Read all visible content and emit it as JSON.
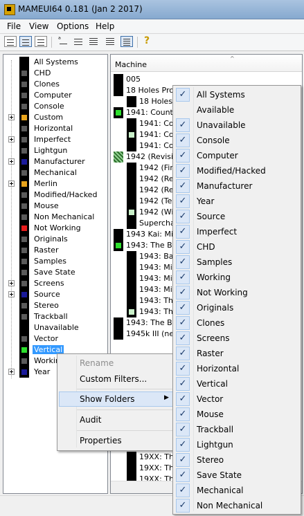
{
  "window": {
    "title": "MAMEUI64 0.181 (Jan  2 2017)"
  },
  "menu": [
    "File",
    "View",
    "Options",
    "Help"
  ],
  "toolbar": {
    "buttons": [
      "large-icons-icon",
      "small-icons-icon",
      "list-icon",
      "details-icon",
      "grouped-icon",
      "help-icon"
    ]
  },
  "tree": {
    "items": [
      {
        "label": "All Systems",
        "expandable": false,
        "icon_color": "#000000"
      },
      {
        "label": "CHD",
        "expandable": false,
        "icon_color": "#5a5a5a"
      },
      {
        "label": "Clones",
        "expandable": false,
        "icon_color": "#5a5a5a"
      },
      {
        "label": "Computer",
        "expandable": false,
        "icon_color": "#5a5a5a"
      },
      {
        "label": "Console",
        "expandable": false,
        "icon_color": "#5a5a5a"
      },
      {
        "label": "Custom",
        "expandable": true,
        "icon_color": "#e8a41c"
      },
      {
        "label": "Horizontal",
        "expandable": false,
        "icon_color": "#5a5a5a"
      },
      {
        "label": "Imperfect",
        "expandable": true,
        "icon_color": "#5a5a5a"
      },
      {
        "label": "Lightgun",
        "expandable": false,
        "icon_color": "#5a5a5a"
      },
      {
        "label": "Manufacturer",
        "expandable": true,
        "icon_color": "#1a1a9a"
      },
      {
        "label": "Mechanical",
        "expandable": false,
        "icon_color": "#5a5a5a"
      },
      {
        "label": "Merlin",
        "expandable": true,
        "icon_color": "#e8a41c"
      },
      {
        "label": "Modified/Hacked",
        "expandable": false,
        "icon_color": "#5a5a5a"
      },
      {
        "label": "Mouse",
        "expandable": false,
        "icon_color": "#5a5a5a"
      },
      {
        "label": "Non Mechanical",
        "expandable": false,
        "icon_color": "#5a5a5a"
      },
      {
        "label": "Not Working",
        "expandable": false,
        "icon_color": "#e81c1c"
      },
      {
        "label": "Originals",
        "expandable": false,
        "icon_color": "#5a5a5a"
      },
      {
        "label": "Raster",
        "expandable": false,
        "icon_color": "#5a5a5a"
      },
      {
        "label": "Samples",
        "expandable": false,
        "icon_color": "#5a5a5a"
      },
      {
        "label": "Save State",
        "expandable": false,
        "icon_color": "#5a5a5a"
      },
      {
        "label": "Screens",
        "expandable": true,
        "icon_color": "#5a5a5a"
      },
      {
        "label": "Source",
        "expandable": true,
        "icon_color": "#1a1a9a"
      },
      {
        "label": "Stereo",
        "expandable": false,
        "icon_color": "#5a5a5a"
      },
      {
        "label": "Trackball",
        "expandable": false,
        "icon_color": "#5a5a5a"
      },
      {
        "label": "Unavailable",
        "expandable": false,
        "icon_color": "#000000"
      },
      {
        "label": "Vector",
        "expandable": false,
        "icon_color": "#5a5a5a"
      },
      {
        "label": "Vertical",
        "expandable": false,
        "icon_color": "#2ee02e",
        "selected": true
      },
      {
        "label": "Working",
        "expandable": false,
        "icon_color": "#5a5a5a"
      },
      {
        "label": "Year",
        "expandable": true,
        "icon_color": "#1a1a9a"
      }
    ]
  },
  "list": {
    "column_header": "Machine",
    "rows": [
      {
        "text": "005",
        "indent": 0,
        "icon": "black"
      },
      {
        "text": "18 Holes Pro G",
        "indent": 0,
        "icon": "black"
      },
      {
        "text": "18 Holes P",
        "indent": 1,
        "icon": "black"
      },
      {
        "text": "1941: Counter",
        "indent": 0,
        "icon": "green"
      },
      {
        "text": "1941: Cou",
        "indent": 1,
        "icon": "black"
      },
      {
        "text": "1941: Cou",
        "indent": 1,
        "icon": "lightgreen"
      },
      {
        "text": "1941: Cou",
        "indent": 1,
        "icon": "black"
      },
      {
        "text": "1942 (Revision",
        "indent": 0,
        "icon": "hatch"
      },
      {
        "text": "1942 (Firs",
        "indent": 1,
        "icon": "black"
      },
      {
        "text": "1942 (Rev",
        "indent": 1,
        "icon": "black"
      },
      {
        "text": "1942 (Rev",
        "indent": 1,
        "icon": "black"
      },
      {
        "text": "1942 (Tec",
        "indent": 1,
        "icon": "black"
      },
      {
        "text": "1942 (Will",
        "indent": 1,
        "icon": "lightgreen"
      },
      {
        "text": "Supercha",
        "indent": 1,
        "icon": "black"
      },
      {
        "text": "1943 Kai: Mid",
        "indent": 0,
        "icon": "black"
      },
      {
        "text": "1943: The Ba",
        "indent": 0,
        "icon": "green"
      },
      {
        "text": "1943: Bat",
        "indent": 1,
        "icon": "black"
      },
      {
        "text": "1943: Mid",
        "indent": 1,
        "icon": "black"
      },
      {
        "text": "1943: Mid",
        "indent": 1,
        "icon": "black"
      },
      {
        "text": "1943: Mid",
        "indent": 1,
        "icon": "black"
      },
      {
        "text": "1943: The",
        "indent": 1,
        "icon": "black"
      },
      {
        "text": "1943: The",
        "indent": 1,
        "icon": "lightgreen"
      },
      {
        "text": "1943: The Ba",
        "indent": 0,
        "icon": "black"
      },
      {
        "text": "1945k III (new",
        "indent": 0,
        "icon": "black"
      }
    ],
    "lower_rows": [
      {
        "text": "19XX: The",
        "indent": 1,
        "icon": "black"
      },
      {
        "text": "19XX: The",
        "indent": 1,
        "icon": "black"
      },
      {
        "text": "19XX: The",
        "indent": 1,
        "icon": "black"
      }
    ]
  },
  "context_menu": {
    "items": [
      {
        "label": "Rename",
        "disabled": true
      },
      {
        "label": "Custom Filters..."
      },
      {
        "label": "Show Folders",
        "submenu": true,
        "highlighted": true
      },
      {
        "label": "Audit"
      },
      {
        "label": "Properties"
      }
    ]
  },
  "show_folders_submenu": {
    "items": [
      {
        "label": "All Systems",
        "checked": true
      },
      {
        "label": "Available",
        "checked": false
      },
      {
        "label": "Unavailable",
        "checked": true
      },
      {
        "label": "Console",
        "checked": true
      },
      {
        "label": "Computer",
        "checked": true
      },
      {
        "label": "Modified/Hacked",
        "checked": true
      },
      {
        "label": "Manufacturer",
        "checked": true
      },
      {
        "label": "Year",
        "checked": true
      },
      {
        "label": "Source",
        "checked": true
      },
      {
        "label": "Imperfect",
        "checked": true
      },
      {
        "label": "CHD",
        "checked": true
      },
      {
        "label": "Samples",
        "checked": true
      },
      {
        "label": "Working",
        "checked": true
      },
      {
        "label": "Not Working",
        "checked": true
      },
      {
        "label": "Originals",
        "checked": true
      },
      {
        "label": "Clones",
        "checked": true
      },
      {
        "label": "Screens",
        "checked": true
      },
      {
        "label": "Raster",
        "checked": true
      },
      {
        "label": "Horizontal",
        "checked": true
      },
      {
        "label": "Vertical",
        "checked": true
      },
      {
        "label": "Vector",
        "checked": true
      },
      {
        "label": "Mouse",
        "checked": true
      },
      {
        "label": "Trackball",
        "checked": true
      },
      {
        "label": "Lightgun",
        "checked": true
      },
      {
        "label": "Stereo",
        "checked": true
      },
      {
        "label": "Save State",
        "checked": true
      },
      {
        "label": "Mechanical",
        "checked": true
      },
      {
        "label": "Non Mechanical",
        "checked": true
      }
    ]
  }
}
